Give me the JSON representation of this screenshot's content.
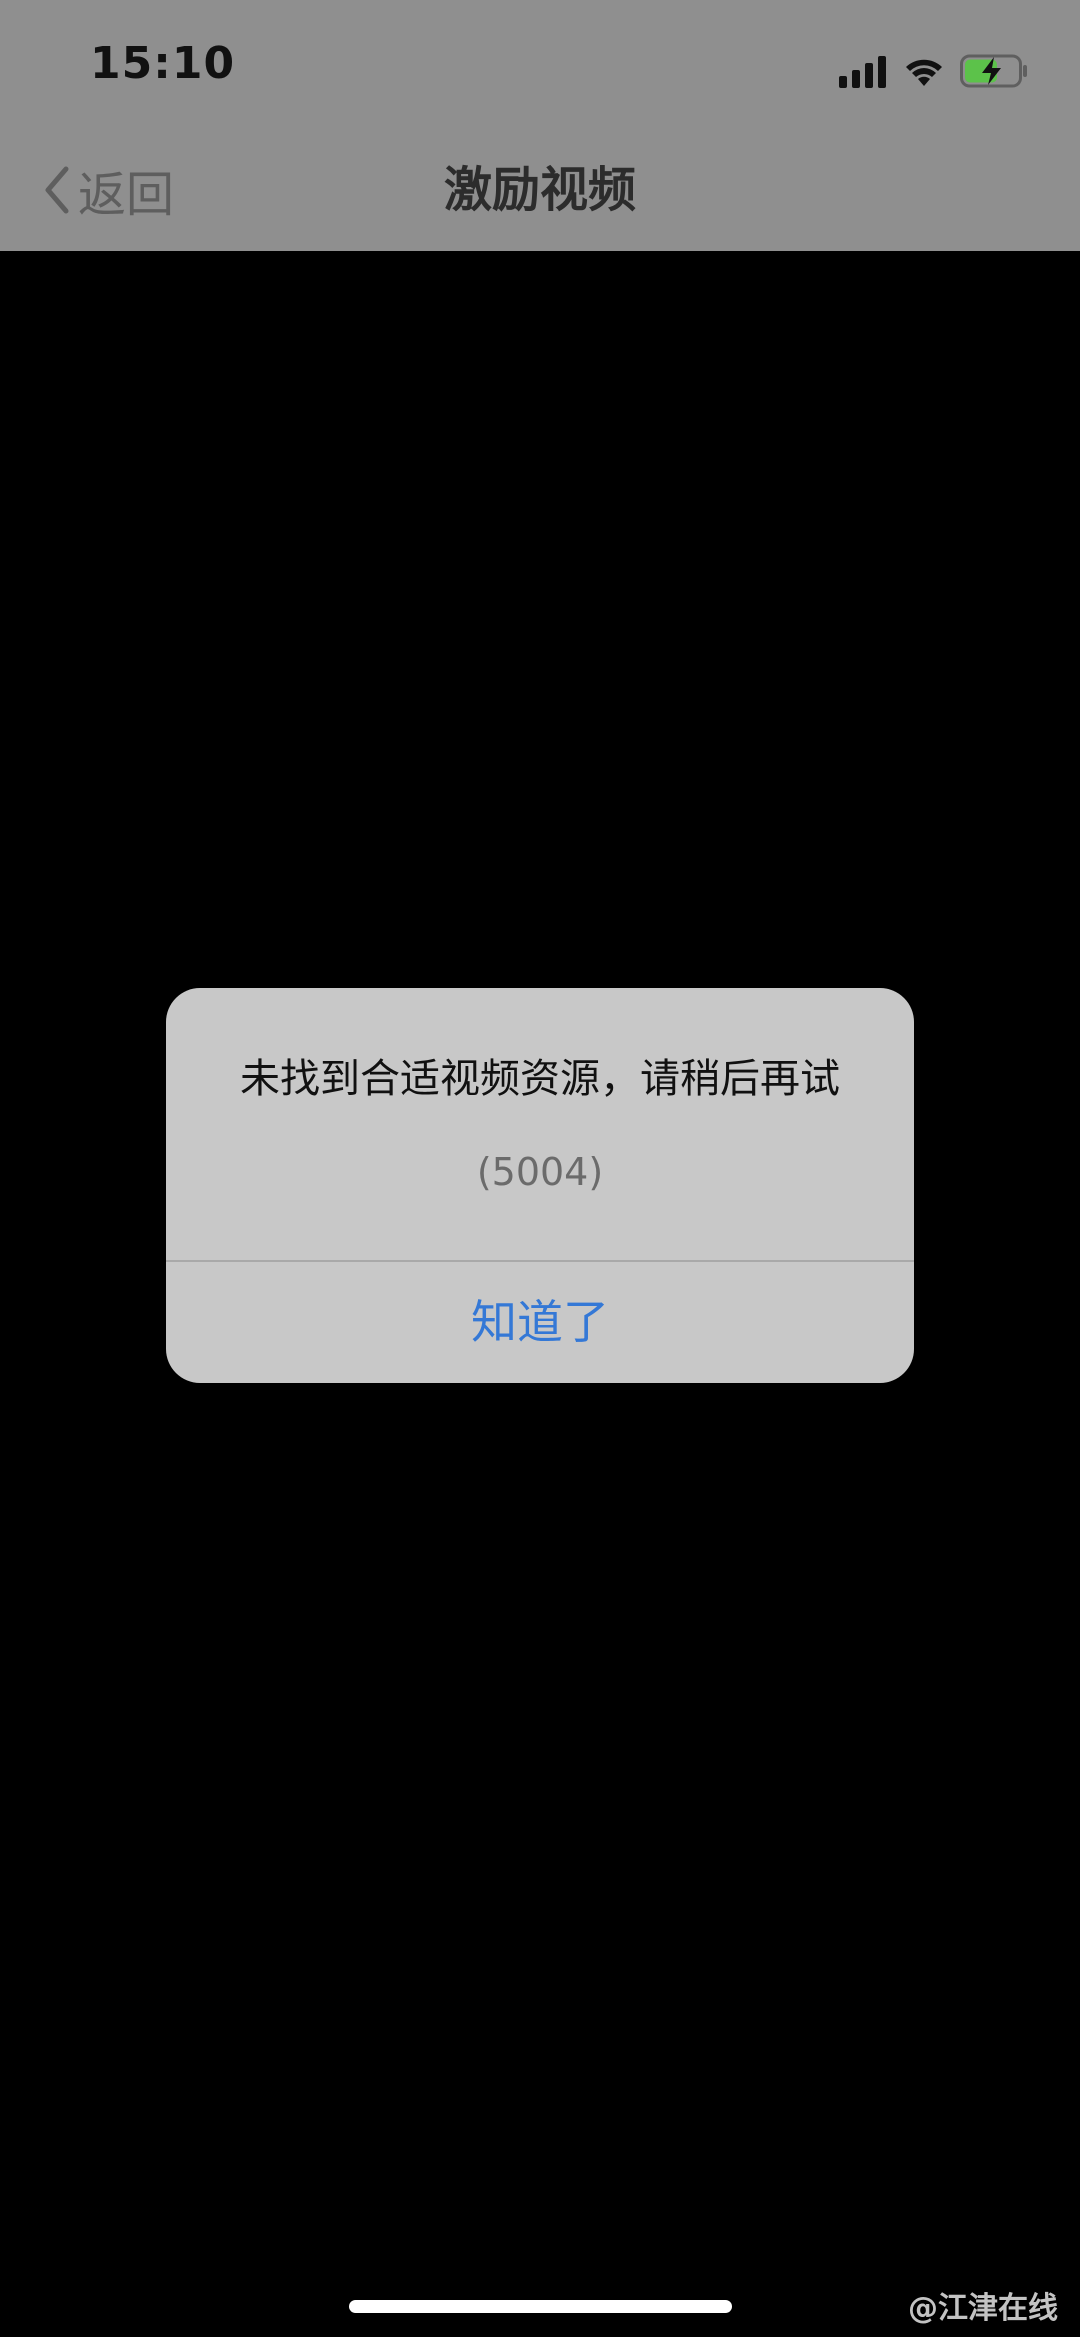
{
  "status_bar": {
    "time": "15:10",
    "signal_icon": "cellular-signal-icon",
    "wifi_icon": "wifi-icon",
    "battery_icon": "battery-charging-icon",
    "battery_color": "#5cc24a"
  },
  "nav": {
    "back_label": "返回",
    "back_icon": "chevron-left-icon",
    "title": "激励视频"
  },
  "alert": {
    "message": "未找到合适视频资源，请稍后再试",
    "code": "(5004)",
    "button_label": "知道了",
    "button_color": "#3478d6"
  },
  "watermark": "@江津在线"
}
